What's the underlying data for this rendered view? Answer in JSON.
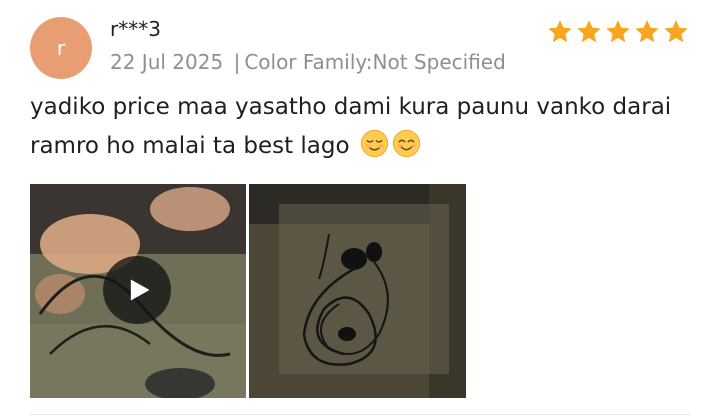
{
  "review": {
    "avatar_initial": "r",
    "username": "r***3",
    "date": "22 Jul 2025",
    "separator": "|",
    "variant": "Color Family:Not Specified",
    "rating": 5,
    "text": "yadiko price maa yasatho dami kura paunu vanko darai ramro ho malai ta best lago",
    "emojis": [
      "relieved-face-icon",
      "smiling-face-icon"
    ],
    "media": [
      {
        "type": "video",
        "icon": "play-icon"
      },
      {
        "type": "photo"
      }
    ]
  },
  "colors": {
    "avatar": "#e89e72",
    "star": "#f7a61d",
    "meta_text": "#8f8f8f"
  }
}
